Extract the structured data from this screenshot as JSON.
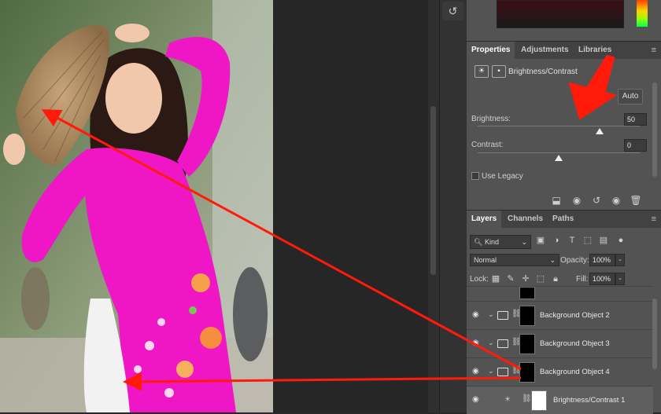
{
  "toolstrip": {
    "history_icon": "history-brush-icon"
  },
  "panel_tabs": [
    "Properties",
    "Adjustments",
    "Libraries"
  ],
  "properties": {
    "title": "Brightness/Contrast",
    "auto_label": "Auto",
    "brightness_label": "Brightness:",
    "brightness_value": "50",
    "brightness_fraction": 0.75,
    "contrast_label": "Contrast:",
    "contrast_value": "0",
    "contrast_fraction": 0.5,
    "legacy_label": "Use Legacy",
    "legacy_checked": false
  },
  "layers_tabs": [
    "Layers",
    "Channels",
    "Paths"
  ],
  "layers": {
    "kind_label": "Kind",
    "blend_mode": "Normal",
    "opacity_label": "Opacity:",
    "opacity_value": "100%",
    "lock_label": "Lock:",
    "fill_label": "Fill:",
    "fill_value": "100%",
    "rows": [
      {
        "name": "Background Object 2"
      },
      {
        "name": "Background Object 3"
      },
      {
        "name": "Background Object 4"
      },
      {
        "name": "Brightness/Contrast 1"
      }
    ]
  },
  "colors": {
    "accent_arrow": "#ff1a0a",
    "panel_bg": "#535353",
    "tab_bar": "#424242"
  }
}
